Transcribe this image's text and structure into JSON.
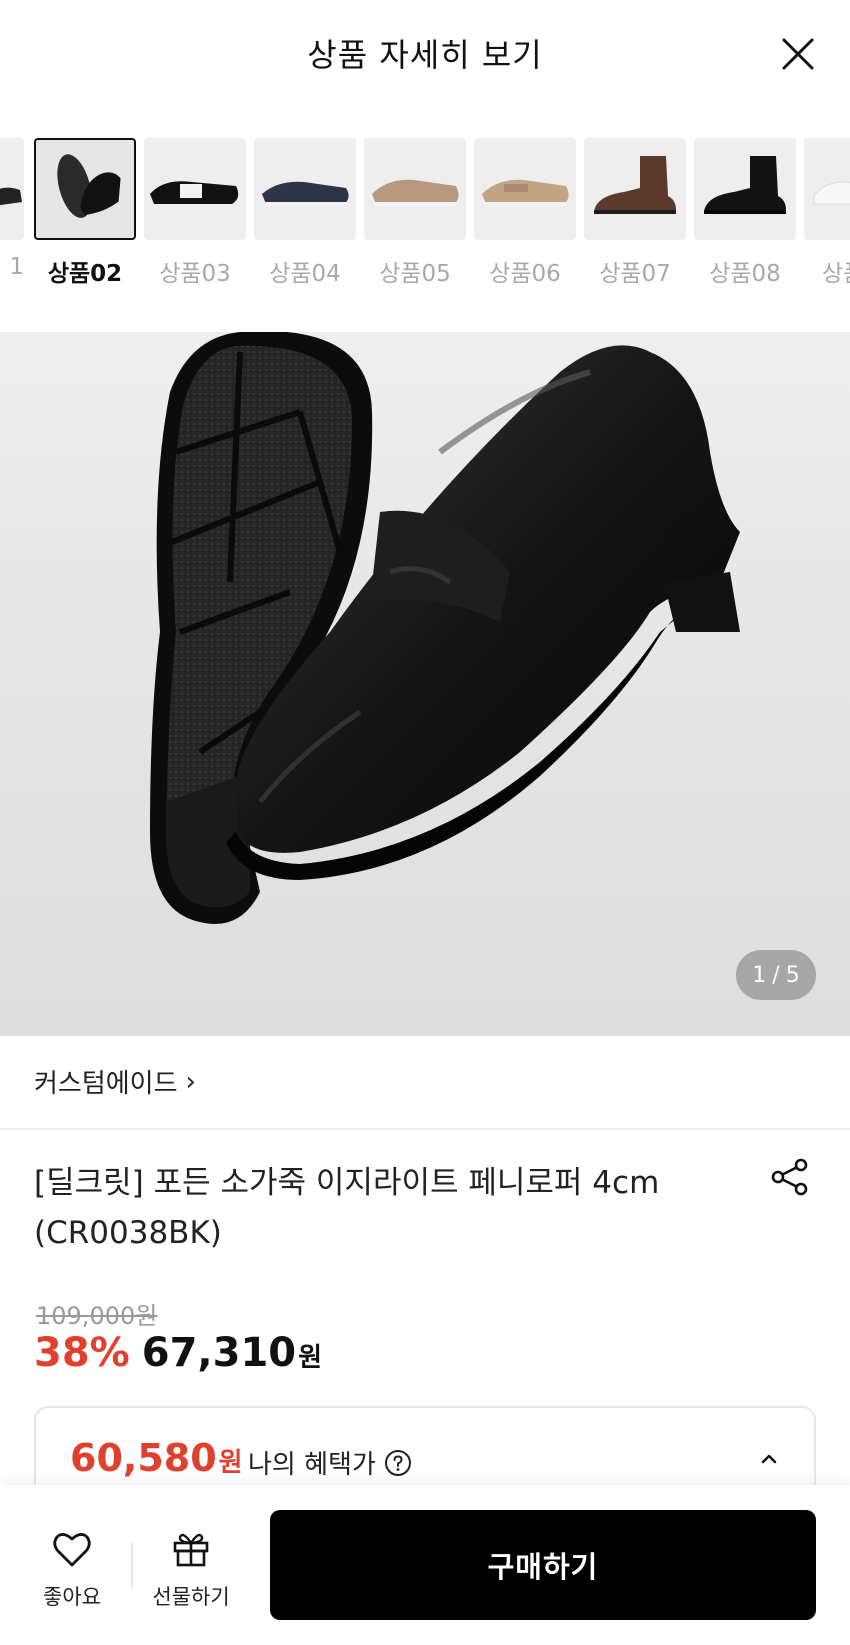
{
  "header": {
    "title": "상품 자세히 보기",
    "close_icon": "close-icon"
  },
  "thumbnails": [
    {
      "label": "1",
      "active": false,
      "shoe": "partial-loafer"
    },
    {
      "label": "상품02",
      "active": true,
      "shoe": "black-penny-loafer"
    },
    {
      "label": "상품03",
      "active": false,
      "shoe": "black-white-loafer"
    },
    {
      "label": "상품04",
      "active": false,
      "shoe": "navy-suede-loafer"
    },
    {
      "label": "상품05",
      "active": false,
      "shoe": "beige-suede-loafer"
    },
    {
      "label": "상품06",
      "active": false,
      "shoe": "beige-penny-loafer"
    },
    {
      "label": "상품07",
      "active": false,
      "shoe": "brown-chelsea-boot"
    },
    {
      "label": "상품08",
      "active": false,
      "shoe": "black-chelsea-boot"
    },
    {
      "label": "상품",
      "active": false,
      "shoe": "white-sneaker"
    }
  ],
  "gallery": {
    "current": "1",
    "separator": "/",
    "total": "5"
  },
  "brand": {
    "name": "커스텀에이드",
    "chevron": "›"
  },
  "product": {
    "title_line1": "[딜크릿] 포든 소가죽 이지라이트 페니로퍼 4cm",
    "title_line2": "(CR0038BK)"
  },
  "price": {
    "original": "109,000원",
    "discount": "38%",
    "sale": "67,310",
    "currency": "원"
  },
  "benefit": {
    "price": "60,580",
    "currency": "원",
    "label": "나의 혜택가",
    "help_icon": "question-circle-icon",
    "toggle_icon": "chevron-up-icon"
  },
  "bottom_bar": {
    "like_label": "좋아요",
    "gift_label": "선물하기",
    "buy_label": "구매하기"
  },
  "colors": {
    "accent_red": "#e0412f",
    "buy_button": "#000000"
  }
}
